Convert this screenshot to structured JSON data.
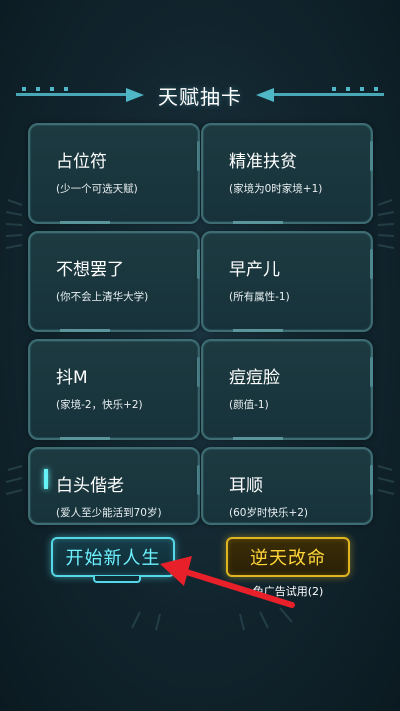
{
  "header": {
    "title": "天赋抽卡"
  },
  "talent_cards": [
    {
      "name": "占位符",
      "desc": "(少一个可选天赋)",
      "selected": false
    },
    {
      "name": "精准扶贫",
      "desc": "(家境为0时家境+1)",
      "selected": false
    },
    {
      "name": "不想罢了",
      "desc": "(你不会上清华大学)",
      "selected": false
    },
    {
      "name": "早产儿",
      "desc": "(所有属性-1)",
      "selected": false
    },
    {
      "name": "抖M",
      "desc": "(家境-2，快乐+2)",
      "selected": false
    },
    {
      "name": "痘痘脸",
      "desc": "(颜值-1)",
      "selected": false
    },
    {
      "name": "白头偕老",
      "desc": "(爱人至少能活到70岁)",
      "selected": true
    },
    {
      "name": "耳顺",
      "desc": "(60岁时快乐+2)",
      "selected": false
    }
  ],
  "actions": {
    "start_label": "开始新人生",
    "reroll_label": "逆天改命",
    "reroll_note": "免广告试用(2)"
  },
  "colors": {
    "accent_cyan": "#54d7e6",
    "accent_gold": "#e0b522",
    "arrow_red": "#e8202a"
  }
}
